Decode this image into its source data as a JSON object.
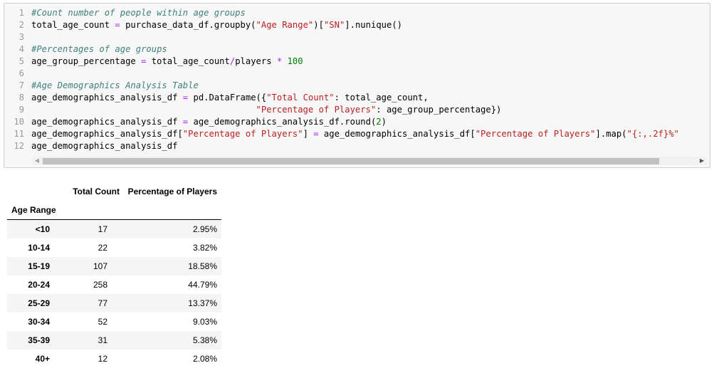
{
  "code_cell": {
    "line_numbers": [
      "1",
      "2",
      "3",
      "4",
      "5",
      "6",
      "7",
      "8",
      "9",
      "10",
      "11",
      "12"
    ],
    "lines": [
      [
        {
          "t": "cm",
          "v": "#Count number of people within age groups"
        }
      ],
      [
        {
          "t": "src",
          "v": "total_age_count "
        },
        {
          "t": "op",
          "v": "="
        },
        {
          "t": "src",
          "v": " purchase_data_df.groupby("
        },
        {
          "t": "st",
          "v": "\"Age Range\""
        },
        {
          "t": "src",
          "v": ")["
        },
        {
          "t": "st",
          "v": "\"SN\""
        },
        {
          "t": "src",
          "v": "].nunique()"
        }
      ],
      [],
      [
        {
          "t": "cm",
          "v": "#Percentages of age groups"
        }
      ],
      [
        {
          "t": "src",
          "v": "age_group_percentage "
        },
        {
          "t": "op",
          "v": "="
        },
        {
          "t": "src",
          "v": " total_age_count"
        },
        {
          "t": "op",
          "v": "/"
        },
        {
          "t": "src",
          "v": "players "
        },
        {
          "t": "op",
          "v": "*"
        },
        {
          "t": "src",
          "v": " "
        },
        {
          "t": "nu",
          "v": "100"
        }
      ],
      [],
      [
        {
          "t": "cm",
          "v": "#Age Demographics Analysis Table"
        }
      ],
      [
        {
          "t": "src",
          "v": "age_demographics_analysis_df "
        },
        {
          "t": "op",
          "v": "="
        },
        {
          "t": "src",
          "v": " pd.DataFrame({"
        },
        {
          "t": "st",
          "v": "\"Total Count\""
        },
        {
          "t": "src",
          "v": ": total_age_count,"
        }
      ],
      [
        {
          "t": "src",
          "v": "                                           "
        },
        {
          "t": "st",
          "v": "\"Percentage of Players\""
        },
        {
          "t": "src",
          "v": ": age_group_percentage})"
        }
      ],
      [
        {
          "t": "src",
          "v": "age_demographics_analysis_df "
        },
        {
          "t": "op",
          "v": "="
        },
        {
          "t": "src",
          "v": " age_demographics_analysis_df.round("
        },
        {
          "t": "nu",
          "v": "2"
        },
        {
          "t": "src",
          "v": ")"
        }
      ],
      [
        {
          "t": "src",
          "v": "age_demographics_analysis_df["
        },
        {
          "t": "st",
          "v": "\"Percentage of Players\""
        },
        {
          "t": "src",
          "v": "] "
        },
        {
          "t": "op",
          "v": "="
        },
        {
          "t": "src",
          "v": " age_demographics_analysis_df["
        },
        {
          "t": "st",
          "v": "\"Percentage of Players\""
        },
        {
          "t": "src",
          "v": "].map("
        },
        {
          "t": "st",
          "v": "\"{:,.2f}%\""
        }
      ],
      [
        {
          "t": "src",
          "v": "age_demographics_analysis_df"
        }
      ]
    ],
    "scroll_left_icon": "triangle-left-icon",
    "scroll_right_icon": "triangle-right-icon",
    "scroll_left_glyph": "◀",
    "scroll_right_glyph": "▶"
  },
  "output_table": {
    "columns": [
      "Total Count",
      "Percentage of Players"
    ],
    "index_name": "Age Range",
    "rows": [
      {
        "label": "<10",
        "total_count": "17",
        "percentage": "2.95%"
      },
      {
        "label": "10-14",
        "total_count": "22",
        "percentage": "3.82%"
      },
      {
        "label": "15-19",
        "total_count": "107",
        "percentage": "18.58%"
      },
      {
        "label": "20-24",
        "total_count": "258",
        "percentage": "44.79%"
      },
      {
        "label": "25-29",
        "total_count": "77",
        "percentage": "13.37%"
      },
      {
        "label": "30-34",
        "total_count": "52",
        "percentage": "9.03%"
      },
      {
        "label": "35-39",
        "total_count": "31",
        "percentage": "5.38%"
      },
      {
        "label": "40+",
        "total_count": "12",
        "percentage": "2.08%"
      }
    ]
  }
}
